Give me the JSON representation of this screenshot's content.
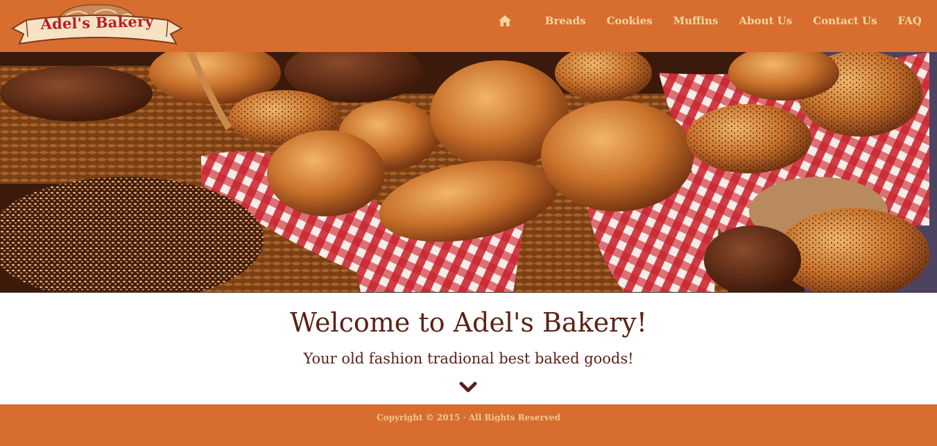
{
  "brand": {
    "logo_text": "Adel's Bakery"
  },
  "nav": {
    "home_icon": "home-icon",
    "links": [
      "Breads",
      "Cookies",
      "Muffins",
      "About Us",
      "Contact Us",
      "FAQ"
    ]
  },
  "hero": {
    "image": "bread-basket-photo"
  },
  "intro": {
    "welcome": "Welcome to Adel's Bakery!",
    "tagline": "Your old fashion tradional best baked goods!",
    "scroll_icon": "chevron-down-icon"
  },
  "footer": {
    "copyright": "Copyright © 2015 · All Rights Reserved"
  },
  "colors": {
    "header_bg": "#d86d30",
    "nav_text": "#f6d7a2",
    "heading_text": "#5b2216",
    "logo_red": "#b51f23"
  }
}
